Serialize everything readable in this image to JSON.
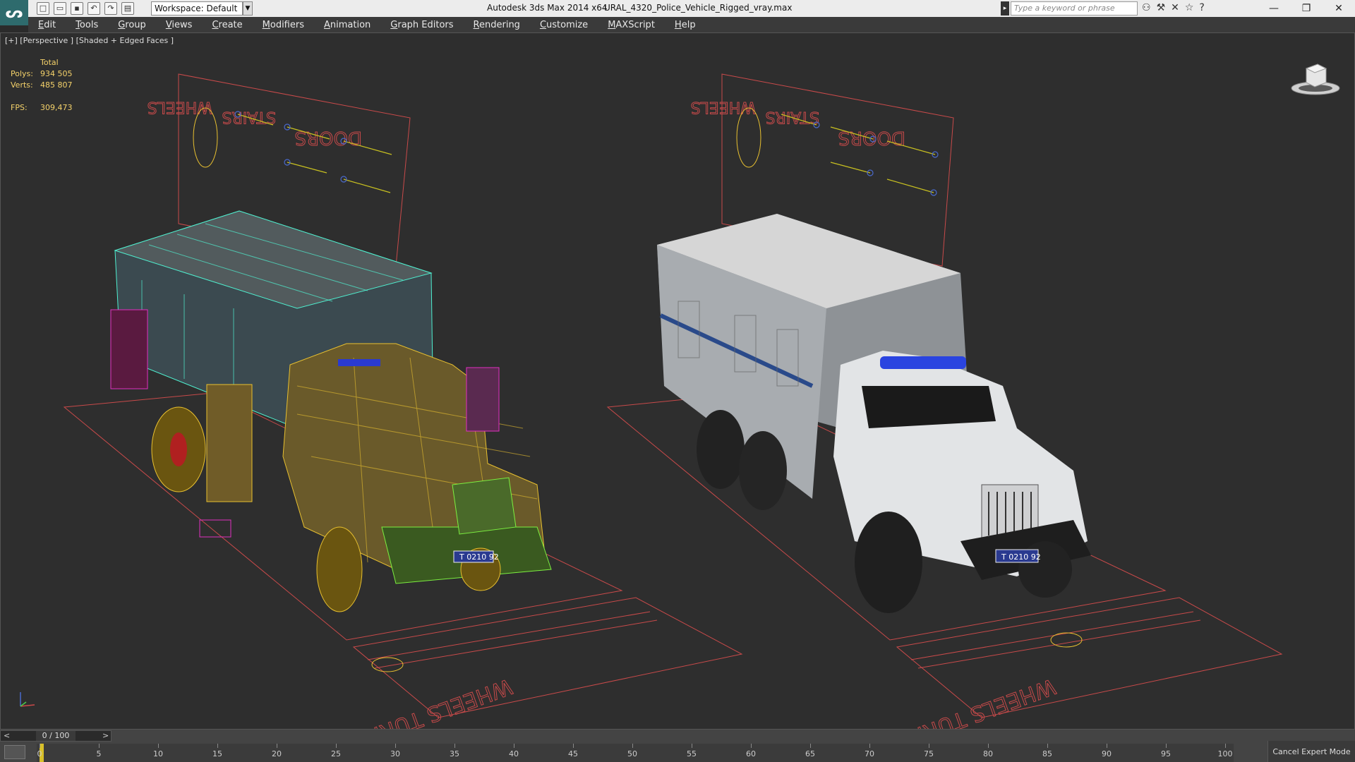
{
  "titlebar": {
    "workspace_label": "Workspace: Default",
    "app_title": "Autodesk 3ds Max  2014 x64",
    "document_title": "URAL_4320_Police_Vehicle_Rigged_vray.max",
    "search_placeholder": "Type a keyword or phrase"
  },
  "menu": [
    "Edit",
    "Tools",
    "Group",
    "Views",
    "Create",
    "Modifiers",
    "Animation",
    "Graph Editors",
    "Rendering",
    "Customize",
    "MAXScript",
    "Help"
  ],
  "viewport": {
    "label": "[+] [Perspective ] [Shaded + Edged Faces ]",
    "stats": {
      "header": "Total",
      "polys_label": "Polys:",
      "polys_value": "934 505",
      "verts_label": "Verts:",
      "verts_value": "485 807",
      "fps_label": "FPS:",
      "fps_value": "309,473"
    },
    "panel_labels": {
      "wheels": "WHEELS",
      "stairs": "STAIRS",
      "doors": "DOORS"
    },
    "floor_label": "WHEELS TURNS",
    "plate_text": "Т 0210 92"
  },
  "timeline": {
    "slider_left": "<",
    "slider_value": "0 / 100",
    "slider_right": ">",
    "ticks": [
      "0",
      "5",
      "10",
      "15",
      "20",
      "25",
      "30",
      "35",
      "40",
      "45",
      "50",
      "55",
      "60",
      "65",
      "70",
      "75",
      "80",
      "85",
      "90",
      "95",
      "100"
    ],
    "cancel_expert_mode": "Cancel Expert Mode"
  },
  "colors": {
    "accent": "#2e6b6d",
    "wire_cyan": "#4ff0d0",
    "wire_yellow": "#e8c030",
    "wire_green": "#7cf040",
    "wire_magenta": "#e030c0",
    "guide_red": "#c84a4a"
  }
}
